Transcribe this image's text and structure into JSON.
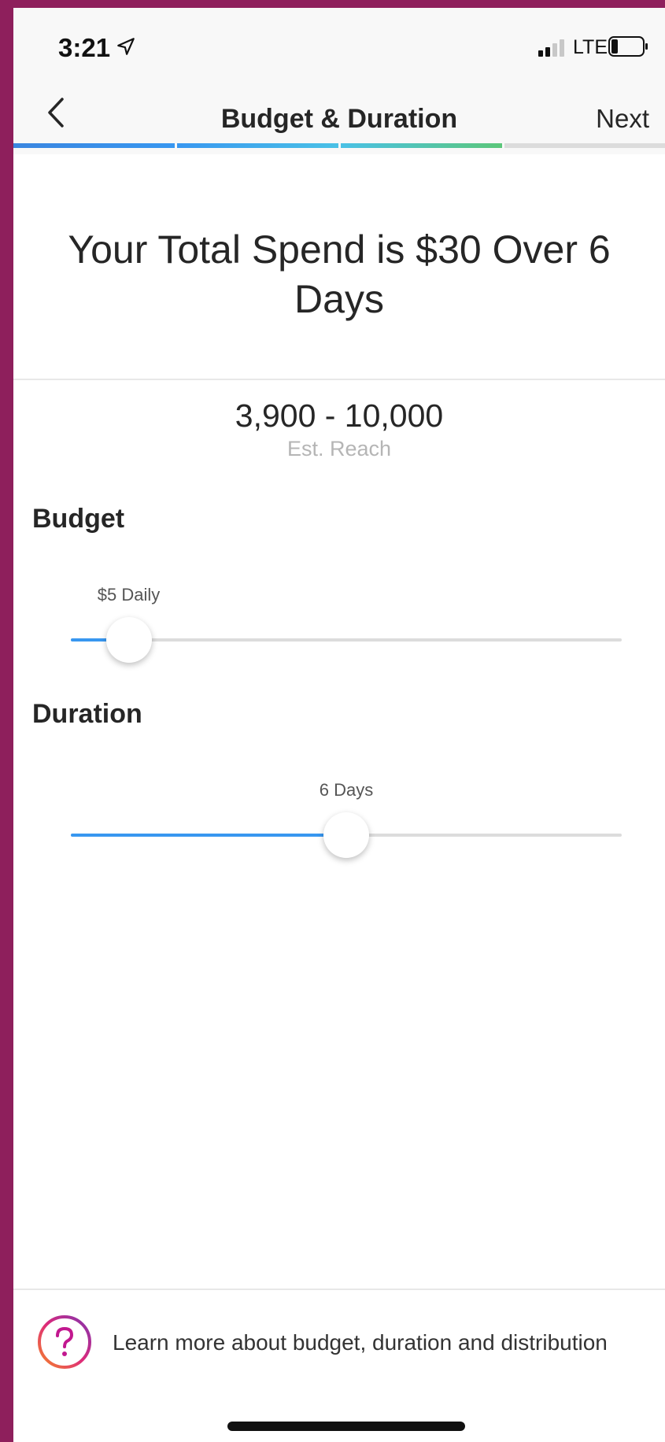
{
  "status_bar": {
    "time": "3:21",
    "network": "LTE",
    "icons": [
      "location-arrow-icon",
      "signal-icon",
      "battery-icon"
    ]
  },
  "nav": {
    "title": "Budget & Duration",
    "next_label": "Next",
    "back_icon": "chevron-left-icon",
    "progress_steps": 4,
    "progress_completed": 3
  },
  "summary": {
    "headline": "Your Total Spend is $30 Over 6 Days"
  },
  "reach": {
    "value": "3,900 - 10,000",
    "label": "Est. Reach"
  },
  "budget": {
    "label": "Budget",
    "value_label": "$5 Daily",
    "slider_fraction": 0.105
  },
  "duration": {
    "label": "Duration",
    "value_label": "6 Days",
    "slider_fraction": 0.5
  },
  "help": {
    "icon": "question-circle-icon",
    "text": "Learn more about budget, duration and distribution"
  },
  "colors": {
    "accent": "#3897f0",
    "progress_gradient": [
      "#3897f0",
      "#4ac1e6",
      "#5cc77a"
    ],
    "border": "#8e1f5c"
  }
}
